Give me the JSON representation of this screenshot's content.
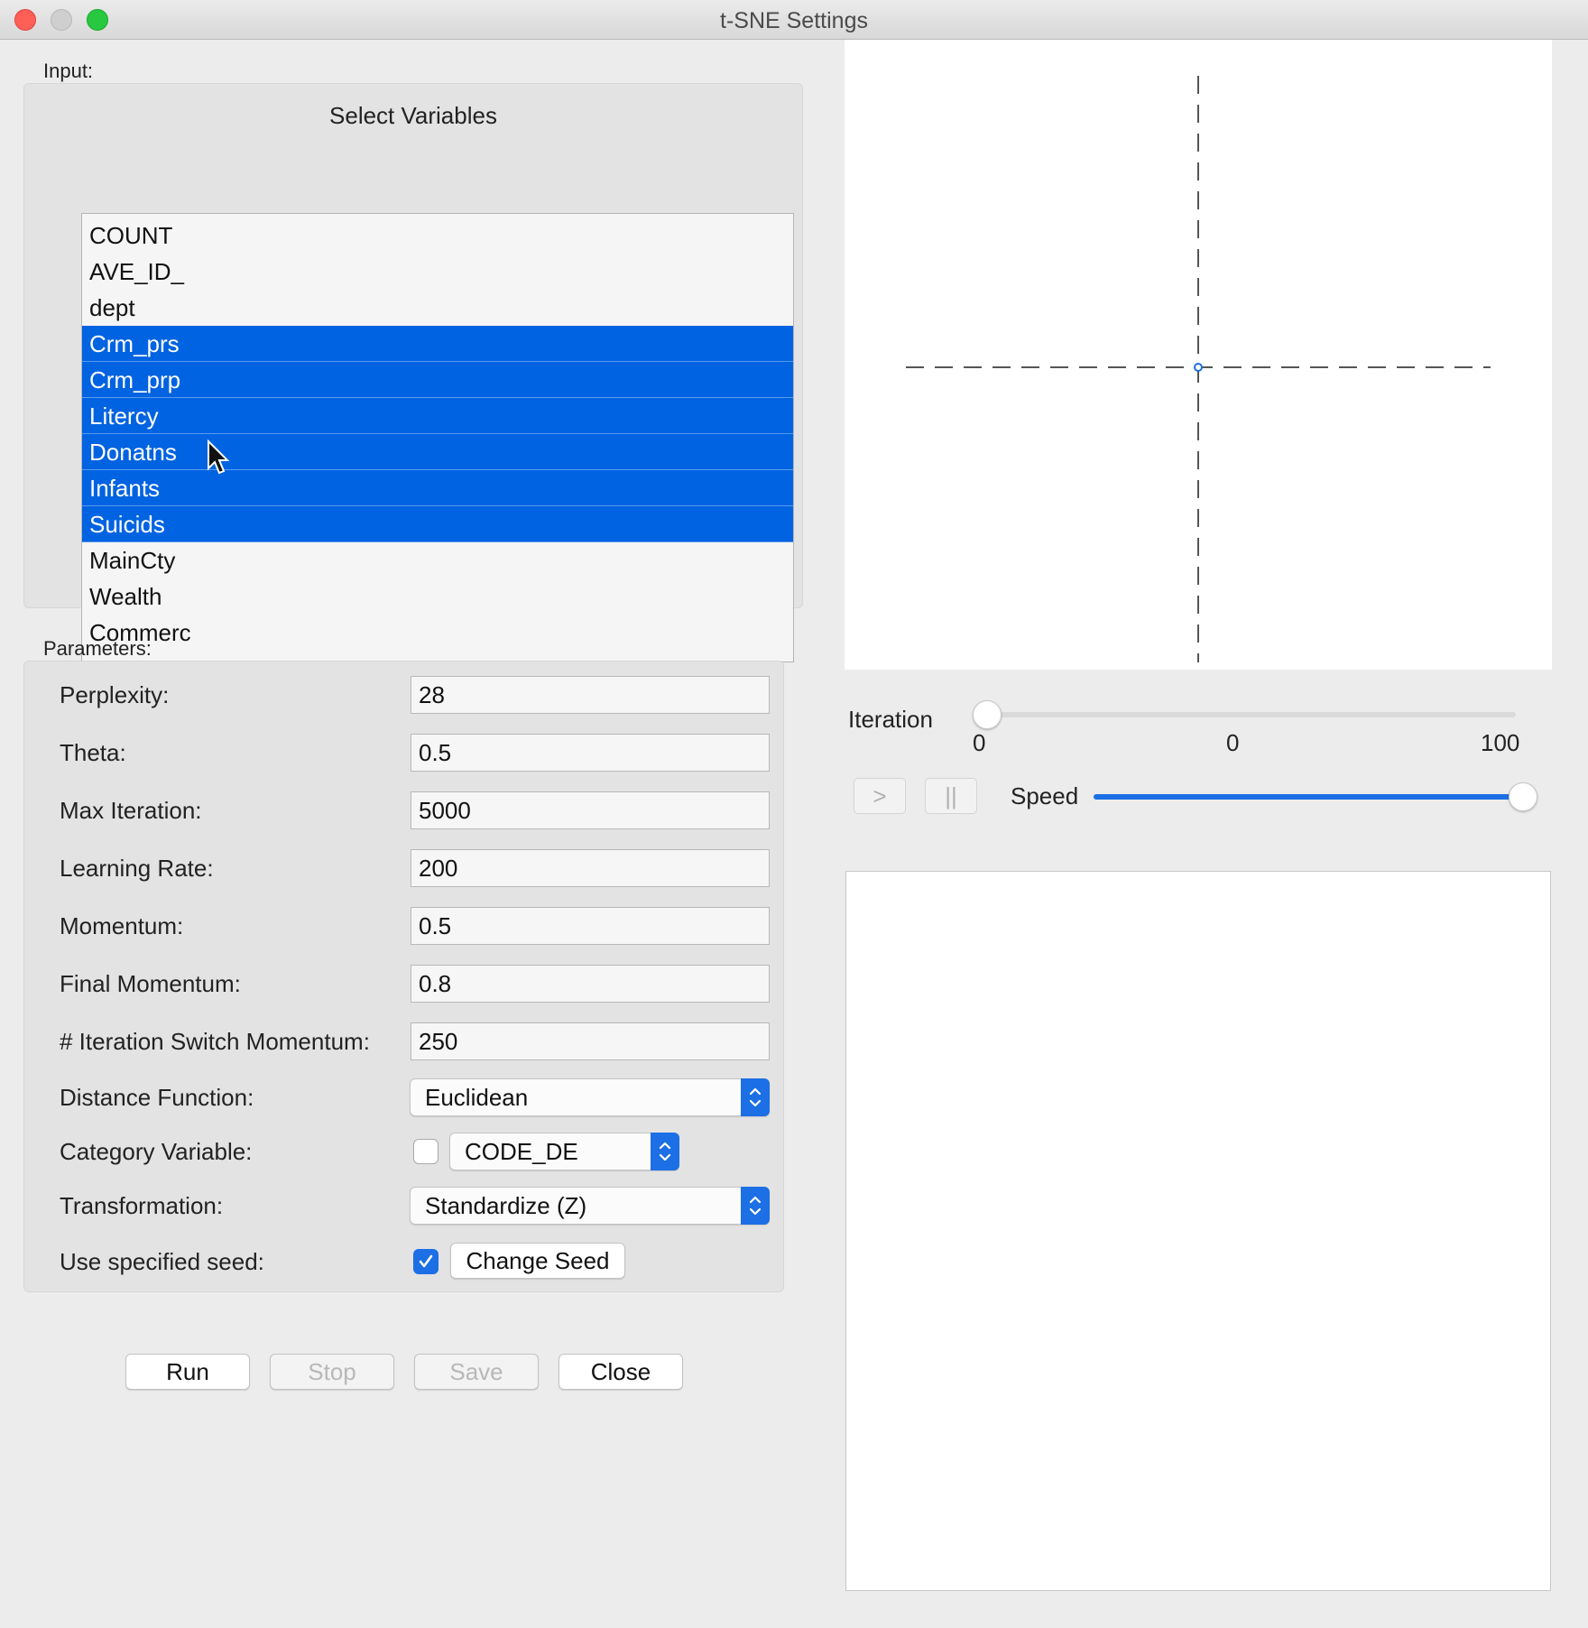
{
  "window": {
    "title": "t-SNE Settings"
  },
  "input": {
    "section_label": "Input:",
    "group_title": "Select Variables",
    "variables": [
      {
        "label": "COUNT",
        "selected": false
      },
      {
        "label": "AVE_ID_",
        "selected": false
      },
      {
        "label": "dept",
        "selected": false
      },
      {
        "label": "Crm_prs",
        "selected": true
      },
      {
        "label": "Crm_prp",
        "selected": true
      },
      {
        "label": "Litercy",
        "selected": true
      },
      {
        "label": "Donatns",
        "selected": true
      },
      {
        "label": "Infants",
        "selected": true
      },
      {
        "label": "Suicids",
        "selected": true
      },
      {
        "label": "MainCty",
        "selected": false
      },
      {
        "label": "Wealth",
        "selected": false
      },
      {
        "label": "Commerc",
        "selected": false
      }
    ]
  },
  "parameters": {
    "section_label": "Parameters:",
    "perplexity": {
      "label": "Perplexity:",
      "value": "28"
    },
    "theta": {
      "label": "Theta:",
      "value": "0.5"
    },
    "max_iteration": {
      "label": "Max Iteration:",
      "value": "5000"
    },
    "learning_rate": {
      "label": "Learning Rate:",
      "value": "200"
    },
    "momentum": {
      "label": "Momentum:",
      "value": "0.5"
    },
    "final_momentum": {
      "label": "Final Momentum:",
      "value": "0.8"
    },
    "switch_momentum": {
      "label": "# Iteration Switch Momentum:",
      "value": "250"
    },
    "distance_function": {
      "label": "Distance Function:",
      "value": "Euclidean"
    },
    "category_variable": {
      "label": "Category Variable:",
      "value": "CODE_DE",
      "checked": false
    },
    "transformation": {
      "label": "Transformation:",
      "value": "Standardize (Z)"
    },
    "seed": {
      "label": "Use specified seed:",
      "checked": true,
      "button": "Change Seed"
    }
  },
  "buttons": {
    "run": "Run",
    "stop": "Stop",
    "save": "Save",
    "close": "Close"
  },
  "iteration": {
    "label": "Iteration",
    "min": "0",
    "current": "0",
    "max": "100",
    "play": ">",
    "pause": "||",
    "speed_label": "Speed",
    "speed_level": 1.0
  },
  "colors": {
    "accent": "#1c6fe5",
    "selection": "#0063e1"
  }
}
